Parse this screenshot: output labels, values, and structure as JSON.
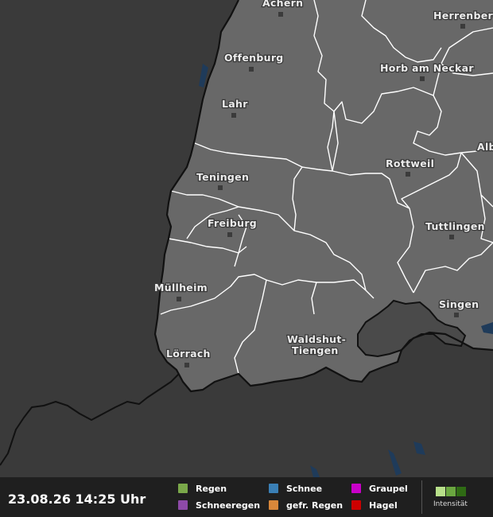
{
  "map": {
    "cities": [
      {
        "id": "achern",
        "name": "Achern"
      },
      {
        "id": "herrenberg",
        "name": "Herrenberg"
      },
      {
        "id": "offenburg",
        "name": "Offenburg"
      },
      {
        "id": "horb",
        "name": "Horb am Neckar"
      },
      {
        "id": "lahr",
        "name": "Lahr"
      },
      {
        "id": "singen-alb",
        "name": "Alb"
      },
      {
        "id": "teningen",
        "name": "Teningen"
      },
      {
        "id": "rottweil",
        "name": "Rottweil"
      },
      {
        "id": "freiburg",
        "name": "Freiburg"
      },
      {
        "id": "tuttlingen",
        "name": "Tuttlingen"
      },
      {
        "id": "muellheim",
        "name": "Müllheim"
      },
      {
        "id": "singen",
        "name": "Singen"
      },
      {
        "id": "loerrach",
        "name": "Lörrach"
      },
      {
        "id": "waldshut-1",
        "name": "Waldshut-"
      },
      {
        "id": "waldshut-2",
        "name": "Tiengen"
      }
    ],
    "colors": {
      "background": "#3a3a3a",
      "land": "#686868",
      "hole": "#4a4a4a",
      "water": "#1f3b5a",
      "border_internal": "#ffffff",
      "border_national": "#111111"
    }
  },
  "legend": {
    "timestamp": "23.08.26 14:25 Uhr",
    "items": [
      {
        "label": "Regen",
        "color": "#7aa84a"
      },
      {
        "label": "Schneeregen",
        "color": "#8e4aa8"
      },
      {
        "label": "Schnee",
        "color": "#3a7fb5"
      },
      {
        "label": "gefr. Regen",
        "color": "#d9873a"
      },
      {
        "label": "Graupel",
        "color": "#c800c8"
      },
      {
        "label": "Hagel",
        "color": "#cc0000"
      }
    ],
    "intensity_label": "Intensität",
    "intensity_colors": [
      "#b8e08a",
      "#6aa640",
      "#2f6b14"
    ]
  }
}
